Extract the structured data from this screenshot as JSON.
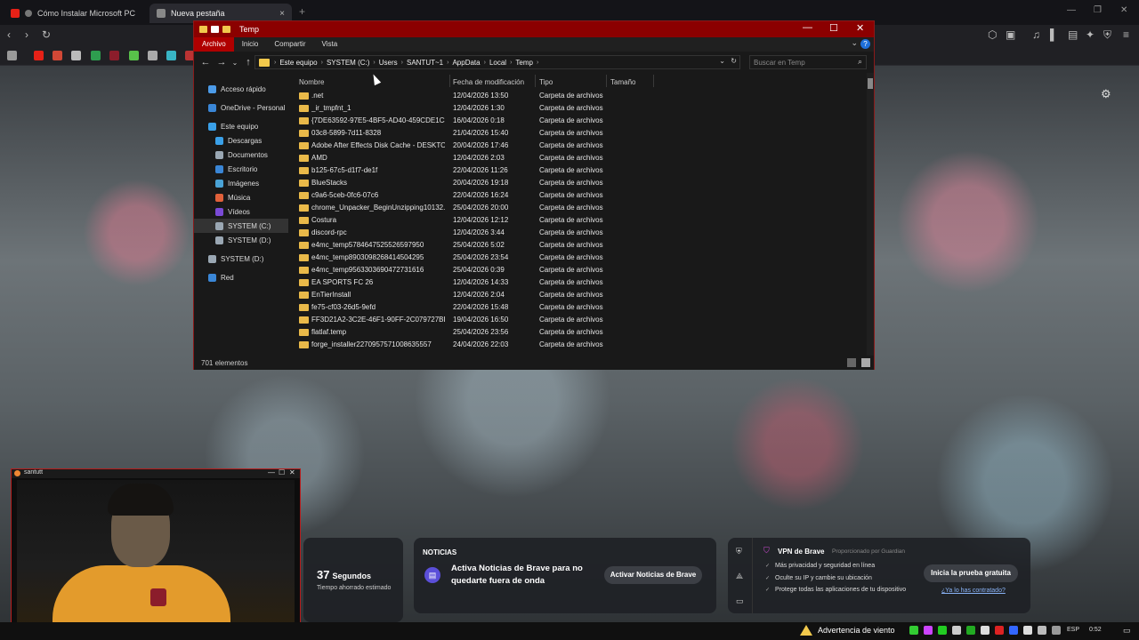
{
  "browser": {
    "tabs": [
      {
        "label": "Cómo Instalar Microsoft PC Mana",
        "icon": "youtube-icon"
      },
      {
        "label": "Nueva pestaña",
        "icon": "brave-shield-icon"
      }
    ],
    "new_tab": "+",
    "close": "×"
  },
  "explorer": {
    "title": "Temp",
    "ribbon_tabs": [
      "Archivo",
      "Inicio",
      "Compartir",
      "Vista"
    ],
    "help": "?",
    "breadcrumb": [
      "Este equipo",
      "SYSTEM (C:)",
      "Users",
      "SANTUT~1",
      "AppData",
      "Local",
      "Temp"
    ],
    "search_placeholder": "Buscar en Temp",
    "nav_items": [
      {
        "label": "Acceso rápido",
        "color": "#4c9be8"
      },
      {
        "label": "OneDrive - Personal",
        "color": "#3a86d6"
      },
      {
        "label": "Este equipo",
        "color": "#3aa0e8"
      },
      {
        "label": "Descargas",
        "color": "#3aa0e8"
      },
      {
        "label": "Documentos",
        "color": "#9aa7b3"
      },
      {
        "label": "Escritorio",
        "color": "#3a86d6"
      },
      {
        "label": "Imágenes",
        "color": "#4aa3d6"
      },
      {
        "label": "Música",
        "color": "#e0603a"
      },
      {
        "label": "Vídeos",
        "color": "#7a4ad6"
      },
      {
        "label": "SYSTEM (C:)",
        "color": "#9aa7b3"
      },
      {
        "label": "SYSTEM (D:)",
        "color": "#9aa7b3"
      },
      {
        "label": "SYSTEM (D:)",
        "color": "#9aa7b3"
      },
      {
        "label": "Red",
        "color": "#3a86d6"
      }
    ],
    "columns": [
      "Nombre",
      "Fecha de modificación",
      "Tipo",
      "Tamaño"
    ],
    "files": [
      {
        "name": ".net",
        "date": "12/04/2026 13:50",
        "type": "Carpeta de archivos"
      },
      {
        "name": "_ir_tmpfnt_1",
        "date": "12/04/2026 1:30",
        "type": "Carpeta de archivos"
      },
      {
        "name": "{7DE63592-97E5-4BF5-AD40-459CDE1C38...",
        "date": "16/04/2026 0:18",
        "type": "Carpeta de archivos"
      },
      {
        "name": "03c8-5899-7d11-8328",
        "date": "21/04/2026 15:40",
        "type": "Carpeta de archivos"
      },
      {
        "name": "Adobe After Effects Disk Cache - DESKTO...",
        "date": "20/04/2026 17:46",
        "type": "Carpeta de archivos"
      },
      {
        "name": "AMD",
        "date": "12/04/2026 2:03",
        "type": "Carpeta de archivos"
      },
      {
        "name": "b125-67c5-d1f7-de1f",
        "date": "22/04/2026 11:26",
        "type": "Carpeta de archivos"
      },
      {
        "name": "BlueStacks",
        "date": "20/04/2026 19:18",
        "type": "Carpeta de archivos"
      },
      {
        "name": "c9a6-5ceb-0fc6-07c6",
        "date": "22/04/2026 16:24",
        "type": "Carpeta de archivos"
      },
      {
        "name": "chrome_Unpacker_BeginUnzipping10132...",
        "date": "25/04/2026 20:00",
        "type": "Carpeta de archivos"
      },
      {
        "name": "Costura",
        "date": "12/04/2026 12:12",
        "type": "Carpeta de archivos"
      },
      {
        "name": "discord-rpc",
        "date": "12/04/2026 3:44",
        "type": "Carpeta de archivos"
      },
      {
        "name": "e4mc_temp5784647525526597950",
        "date": "25/04/2026 5:02",
        "type": "Carpeta de archivos"
      },
      {
        "name": "e4mc_temp8903098268414504295",
        "date": "25/04/2026 23:54",
        "type": "Carpeta de archivos"
      },
      {
        "name": "e4mc_temp9563303690472731616",
        "date": "25/04/2026 0:39",
        "type": "Carpeta de archivos"
      },
      {
        "name": "EA SPORTS FC 26",
        "date": "12/04/2026 14:33",
        "type": "Carpeta de archivos"
      },
      {
        "name": "EnTierInstall",
        "date": "12/04/2026 2:04",
        "type": "Carpeta de archivos"
      },
      {
        "name": "fe75-cf03-26d5-9efd",
        "date": "22/04/2026 15:48",
        "type": "Carpeta de archivos"
      },
      {
        "name": "FF3D21A2-3C2E-46F1-90FF-2C079727BE85",
        "date": "19/04/2026 16:50",
        "type": "Carpeta de archivos"
      },
      {
        "name": "flatlaf.temp",
        "date": "25/04/2026 23:56",
        "type": "Carpeta de archivos"
      },
      {
        "name": "forge_installer2270957571008635557",
        "date": "24/04/2026 22:03",
        "type": "Carpeta de archivos"
      }
    ],
    "status": "701 elementos"
  },
  "webcam": {
    "title": "santutt"
  },
  "brave": {
    "time_value": "37",
    "time_unit": "Segundos",
    "time_caption": "Tiempo ahorrado estimado",
    "news_header": "NOTICIAS",
    "news_message": "Activa Noticias de Brave para no quedarte fuera de onda",
    "news_button": "Activar Noticias de Brave",
    "vpn_title": "VPN de Brave",
    "vpn_provider": "Proporcionado por Guardian",
    "vpn_bullets": [
      "Más privacidad y seguridad en línea",
      "Oculte su IP y cambie su ubicación",
      "Protege todas las aplicaciones de tu dispositivo"
    ],
    "vpn_button": "Inicia la prueba gratuita",
    "vpn_link": "¿Ya lo has contratado?"
  },
  "taskbar": {
    "weather_alert": "Advertencia de viento",
    "language": "ESP",
    "clock": "0:52"
  }
}
